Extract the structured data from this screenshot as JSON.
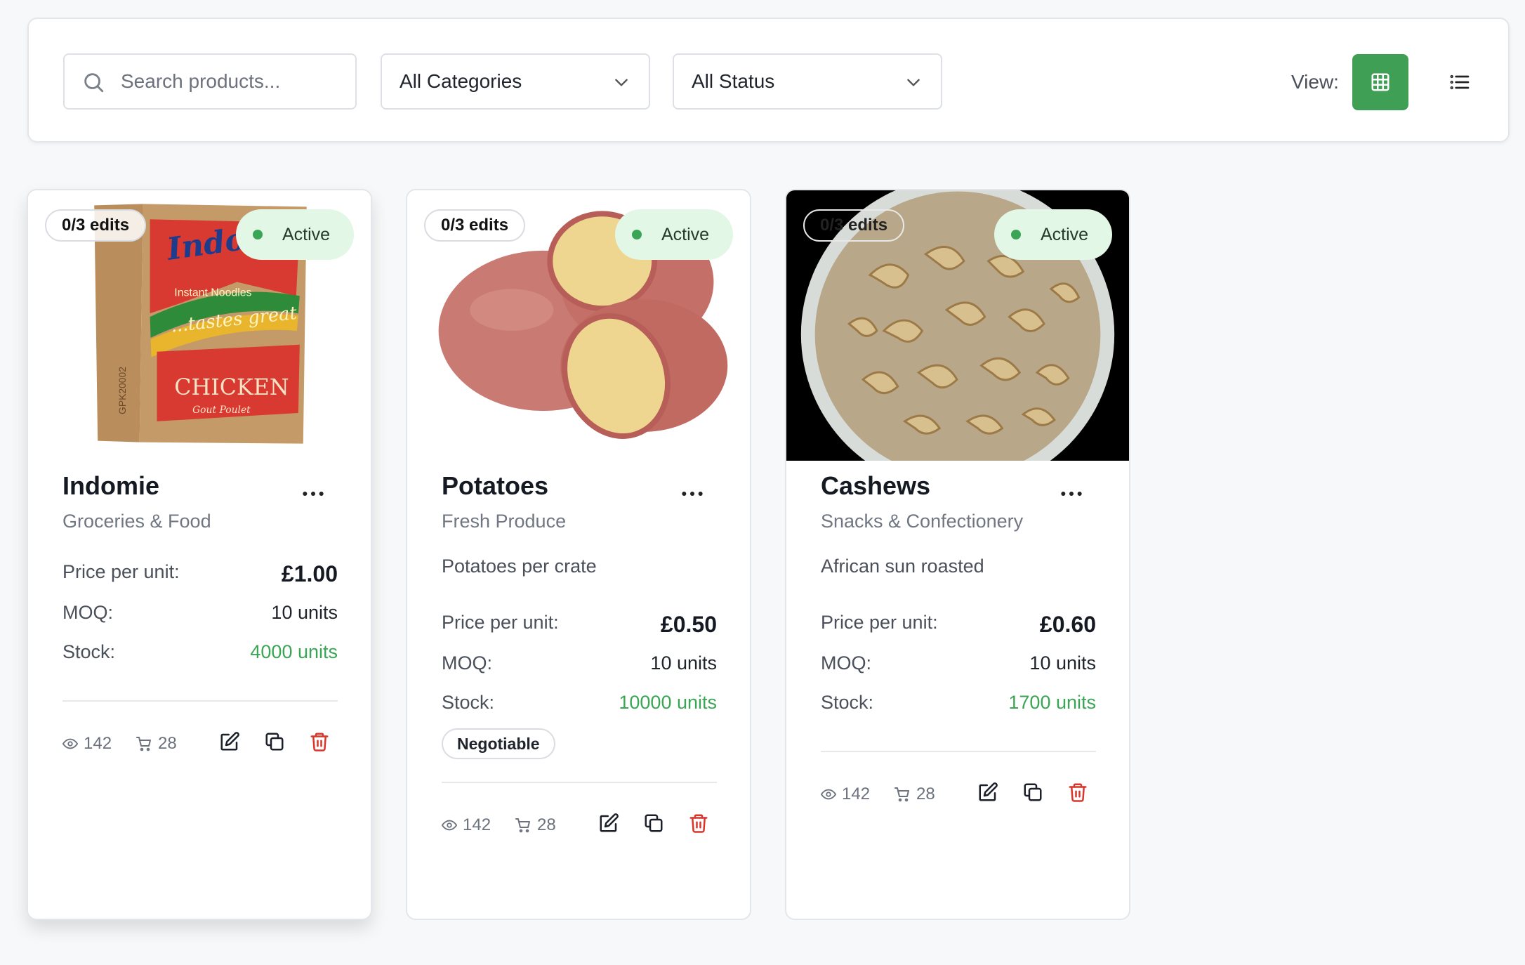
{
  "toolbar": {
    "search_placeholder": "Search products...",
    "category_select": "All Categories",
    "status_select": "All Status",
    "view_label": "View:",
    "active_view": "grid",
    "accent_color": "#3f9f55"
  },
  "products": [
    {
      "image": "indomie-noodles-box",
      "edits": "0/3 edits",
      "status": "Active",
      "name": "Indomie",
      "category": "Groceries & Food",
      "description": "",
      "price_label": "Price per unit:",
      "price": "£1.00",
      "moq_label": "MOQ:",
      "moq": "10 units",
      "stock_label": "Stock:",
      "stock": "4000 units",
      "badge": "",
      "views": "142",
      "carts": "28"
    },
    {
      "image": "red-potatoes",
      "edits": "0/3 edits",
      "status": "Active",
      "name": "Potatoes",
      "category": "Fresh Produce",
      "description": "Potatoes per crate",
      "price_label": "Price per unit:",
      "price": "£0.50",
      "moq_label": "MOQ:",
      "moq": "10 units",
      "stock_label": "Stock:",
      "stock": "10000 units",
      "badge": "Negotiable",
      "views": "142",
      "carts": "28"
    },
    {
      "image": "cashews-bowl",
      "edits": "0/3 edits",
      "status": "Active",
      "name": "Cashews",
      "category": "Snacks & Confectionery",
      "description": "African sun roasted",
      "price_label": "Price per unit:",
      "price": "£0.60",
      "moq_label": "MOQ:",
      "moq": "10 units",
      "stock_label": "Stock:",
      "stock": "1700 units",
      "badge": "",
      "views": "142",
      "carts": "28"
    }
  ]
}
